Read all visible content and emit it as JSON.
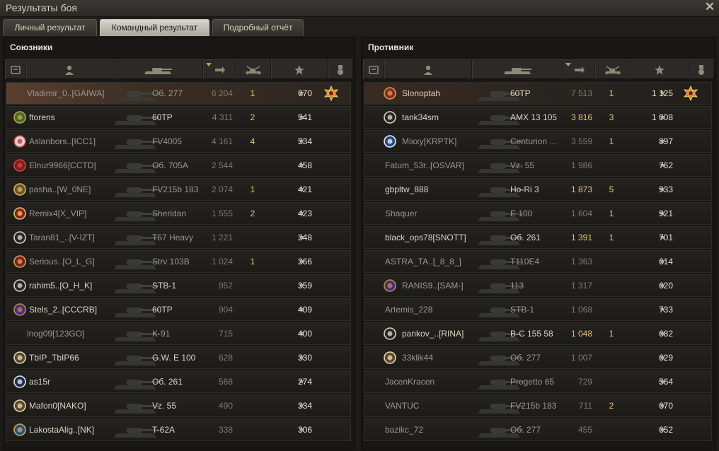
{
  "window": {
    "title": "Результаты боя"
  },
  "tabs": [
    {
      "label": "Личный результат",
      "active": false
    },
    {
      "label": "Командный результат",
      "active": true
    },
    {
      "label": "Подробный отчёт",
      "active": false
    }
  ],
  "allies": {
    "title": "Союзники",
    "rows": [
      {
        "player": "Vladimir_0..[GAIWA]",
        "badge": "",
        "vehicle": "Об. 277",
        "damage": "6 204",
        "damage_hot": false,
        "kills": "1",
        "xp": "670",
        "medal": "order-medal-icon",
        "style": "me",
        "dead": true
      },
      {
        "player": "ftorens",
        "badge": "clan-badge-green",
        "vehicle": "60TP",
        "damage": "4 311",
        "damage_hot": false,
        "kills": "2",
        "xp": "541",
        "medal": "",
        "style": "",
        "dead": false
      },
      {
        "player": "Aslanbors..[ICC1]",
        "badge": "clan-badge-pink",
        "vehicle": "FV4005",
        "damage": "4 161",
        "damage_hot": false,
        "kills": "4",
        "xp": "534",
        "medal": "",
        "style": "",
        "dead": true
      },
      {
        "player": "Elnur9966[CCTD]",
        "badge": "clan-badge-red-lips",
        "vehicle": "Об. 705А",
        "damage": "2 544",
        "damage_hot": false,
        "kills": "",
        "xp": "458",
        "medal": "",
        "style": "",
        "dead": true
      },
      {
        "player": "pasha..[W_0NE]",
        "badge": "clan-badge-gold",
        "vehicle": "FV215b 183",
        "damage": "2 074",
        "damage_hot": false,
        "kills": "1",
        "xp": "421",
        "medal": "",
        "style": "",
        "dead": true
      },
      {
        "player": "Remix4[X_VIP]",
        "badge": "clan-badge-red-star",
        "vehicle": "Sheridan",
        "damage": "1 555",
        "damage_hot": false,
        "kills": "2",
        "xp": "423",
        "medal": "",
        "style": "",
        "dead": true
      },
      {
        "player": "Taran81_..[V-IZT]",
        "badge": "clan-badge-diamond",
        "vehicle": "T57 Heavy",
        "damage": "1 221",
        "damage_hot": false,
        "kills": "",
        "xp": "348",
        "medal": "",
        "style": "",
        "dead": true
      },
      {
        "player": "Serious..[O_L_G]",
        "badge": "clan-badge-wings",
        "vehicle": "Strv 103B",
        "damage": "1 024",
        "damage_hot": false,
        "kills": "1",
        "xp": "366",
        "medal": "",
        "style": "",
        "dead": true
      },
      {
        "player": "rahim5..[O_H_K]",
        "badge": "clan-badge-diamond",
        "vehicle": "STB-1",
        "damage": "952",
        "damage_hot": false,
        "kills": "",
        "xp": "359",
        "medal": "",
        "style": "",
        "dead": false
      },
      {
        "player": "Stels_2..[CCCRB]",
        "badge": "clan-badge-purple",
        "vehicle": "60TP",
        "damage": "904",
        "damage_hot": false,
        "kills": "",
        "xp": "409",
        "medal": "",
        "style": "",
        "dead": false
      },
      {
        "player": "lnog09[123GO]",
        "badge": "",
        "vehicle": "K-91",
        "damage": "715",
        "damage_hot": false,
        "kills": "",
        "xp": "400",
        "medal": "",
        "style": "",
        "dead": true
      },
      {
        "player": "TbIP_TbIP66",
        "badge": "clan-badge-skull",
        "vehicle": "G.W. E 100",
        "damage": "628",
        "damage_hot": false,
        "kills": "",
        "xp": "330",
        "medal": "",
        "style": "",
        "dead": false
      },
      {
        "player": "as15r",
        "badge": "clan-badge-white-flower",
        "vehicle": "Об. 261",
        "damage": "568",
        "damage_hot": false,
        "kills": "",
        "xp": "274",
        "medal": "",
        "style": "",
        "dead": false
      },
      {
        "player": "Mafon0[NAKO]",
        "badge": "clan-badge-skull",
        "vehicle": "Vz. 55",
        "damage": "490",
        "damage_hot": false,
        "kills": "",
        "xp": "334",
        "medal": "",
        "style": "",
        "dead": false
      },
      {
        "player": "LakostaAlig..[NK]",
        "badge": "clan-badge-blue",
        "vehicle": "T-62A",
        "damage": "338",
        "damage_hot": false,
        "kills": "",
        "xp": "306",
        "medal": "",
        "style": "",
        "dead": false
      }
    ]
  },
  "enemies": {
    "title": "Противник",
    "rows": [
      {
        "player": "Slonoptah",
        "badge": "clan-badge-red-shield",
        "vehicle": "60TP",
        "damage": "7 513",
        "damage_hot": false,
        "kills": "1",
        "xp": "1 125",
        "medal": "order-medal-icon",
        "style": "hl",
        "dead": false
      },
      {
        "player": "tank34sm",
        "badge": "clan-badge-diamond",
        "vehicle": "AMX 13 105",
        "damage": "3 816",
        "damage_hot": true,
        "kills": "3",
        "xp": "1 008",
        "medal": "",
        "style": "",
        "dead": false
      },
      {
        "player": "Mixxy[KRPTK]",
        "badge": "clan-badge-blue-star",
        "vehicle": "Centurion ...",
        "damage": "3 559",
        "damage_hot": false,
        "kills": "1",
        "xp": "897",
        "medal": "",
        "style": "",
        "dead": true
      },
      {
        "player": "Fatum_53r..[OSVAR]",
        "badge": "",
        "vehicle": "Vz. 55",
        "damage": "1 986",
        "damage_hot": false,
        "kills": "",
        "xp": "762",
        "medal": "",
        "style": "",
        "dead": true
      },
      {
        "player": "gbpltw_888",
        "badge": "",
        "vehicle": "Ho-Ri 3",
        "damage": "1 873",
        "damage_hot": true,
        "kills": "5",
        "xp": "933",
        "medal": "",
        "style": "",
        "dead": false
      },
      {
        "player": "Shaquer",
        "badge": "",
        "vehicle": "E 100",
        "damage": "1 604",
        "damage_hot": false,
        "kills": "1",
        "xp": "921",
        "medal": "",
        "style": "",
        "dead": true
      },
      {
        "player": "black_ops78[SNOTT]",
        "badge": "",
        "vehicle": "Об. 261",
        "damage": "1 391",
        "damage_hot": true,
        "kills": "1",
        "xp": "701",
        "medal": "",
        "style": "",
        "dead": false
      },
      {
        "player": "ASTRA_TA..[_8_8_]",
        "badge": "",
        "vehicle": "T110E4",
        "damage": "1 363",
        "damage_hot": false,
        "kills": "",
        "xp": "614",
        "medal": "",
        "style": "",
        "dead": true
      },
      {
        "player": "RANIS9..[SAM-]",
        "badge": "clan-badge-purple",
        "vehicle": "113",
        "damage": "1 317",
        "damage_hot": false,
        "kills": "",
        "xp": "620",
        "medal": "",
        "style": "",
        "dead": true
      },
      {
        "player": "Artemis_228",
        "badge": "",
        "vehicle": "STB-1",
        "damage": "1 068",
        "damage_hot": false,
        "kills": "",
        "xp": "733",
        "medal": "",
        "style": "",
        "dead": true
      },
      {
        "player": "pankov_..[RINA]",
        "badge": "clan-badge-diamond",
        "vehicle": "B-C 155 58",
        "damage": "1 048",
        "damage_hot": true,
        "kills": "1",
        "xp": "682",
        "medal": "",
        "style": "",
        "dead": false
      },
      {
        "player": "33klik44",
        "badge": "clan-badge-skull",
        "vehicle": "Об. 277",
        "damage": "1 007",
        "damage_hot": false,
        "kills": "",
        "xp": "629",
        "medal": "",
        "style": "",
        "dead": true
      },
      {
        "player": "JacenKracen",
        "badge": "",
        "vehicle": "Progetto 65",
        "damage": "729",
        "damage_hot": false,
        "kills": "",
        "xp": "564",
        "medal": "",
        "style": "",
        "dead": true
      },
      {
        "player": "VANTUC",
        "badge": "",
        "vehicle": "FV215b 183",
        "damage": "711",
        "damage_hot": false,
        "kills": "2",
        "xp": "670",
        "medal": "",
        "style": "",
        "dead": true
      },
      {
        "player": "bazikc_72",
        "badge": "",
        "vehicle": "Об. 277",
        "damage": "455",
        "damage_hot": false,
        "kills": "",
        "xp": "652",
        "medal": "",
        "style": "",
        "dead": true
      }
    ]
  },
  "header_icons": [
    "squad-icon",
    "player-icon",
    "tank-icon",
    "damage-icon",
    "kills-icon",
    "xp-star-icon",
    "medal-icon"
  ],
  "colors": {
    "accent": "#e4c07a",
    "text": "#d9d3c2",
    "dim": "#9c968a",
    "star": "#b7b1a2"
  },
  "star_glyph": "★"
}
